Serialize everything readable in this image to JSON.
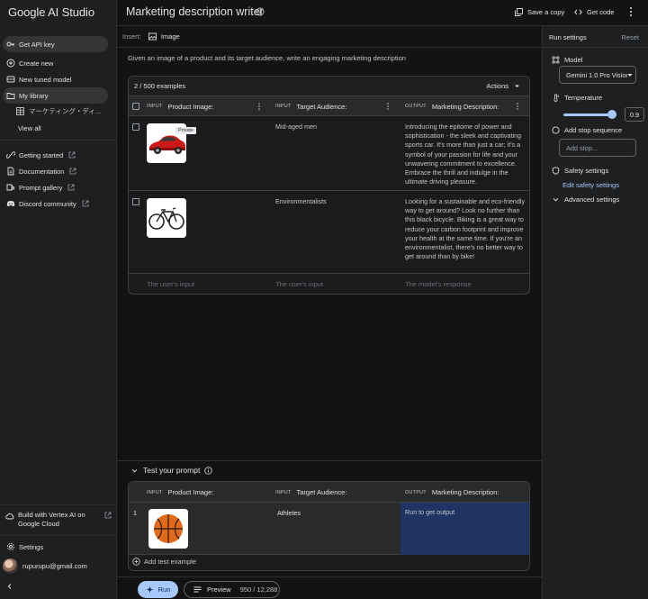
{
  "app": {
    "brand": "Google AI Studio"
  },
  "sidebar": {
    "items": [
      {
        "label": "Get API key",
        "icon": "key-icon"
      },
      {
        "label": "Create new",
        "icon": "plus-circle-icon"
      },
      {
        "label": "New tuned model",
        "icon": "tune-icon"
      },
      {
        "label": "My library",
        "icon": "folder-icon"
      },
      {
        "label": "マーケティング・ディ...",
        "icon": "table-icon"
      },
      {
        "label": "View all"
      },
      {
        "label": "Getting started",
        "icon": "link-icon"
      },
      {
        "label": "Documentation",
        "icon": "document-icon"
      },
      {
        "label": "Prompt gallery",
        "icon": "gallery-icon"
      },
      {
        "label": "Discord community",
        "icon": "discord-icon"
      }
    ],
    "vertex": "Build with Vertex AI on Google Cloud",
    "settings": "Settings",
    "user_email": "rupurupu@gmail.com"
  },
  "header": {
    "title": "Marketing description writer",
    "save_copy": "Save a copy",
    "get_code": "Get code"
  },
  "insert": {
    "label": "Insert:",
    "image": "Image"
  },
  "instruction": "Given an image of a product and its target audience, write an engaging marketing description",
  "examples": {
    "count": "2 / 500 examples",
    "actions": "Actions",
    "columns": [
      {
        "tag": "INPUT",
        "label": "Product Image:"
      },
      {
        "tag": "INPUT",
        "label": "Target Audience:"
      },
      {
        "tag": "OUTPUT",
        "label": "Marketing Description:"
      }
    ],
    "rows": [
      {
        "image": "red-sports-car",
        "badge": "Private",
        "audience": "Mid-aged men",
        "output": "Introducing the epitome of power and sophistication - the sleek and captivating sports car. It's more than just a car; it's a symbol of your passion for life and your unwavering commitment to excellence. Embrace the thrill and indulge in the ultimate driving pleasure."
      },
      {
        "image": "black-bicycle",
        "audience": "Environmentalists",
        "output": "Looking for a sustainable and eco-friendly way to get around? Look no further than this black bicycle. Biking is a great way to reduce your carbon footprint and improve your health at the same time. If you're an environmentalist, there's no better way to get around than by bike!"
      }
    ],
    "placeholders": [
      "The user's input",
      "The user's input",
      "The model's response"
    ]
  },
  "test": {
    "title": "Test your prompt",
    "columns": [
      {
        "tag": "INPUT",
        "label": "Product Image:"
      },
      {
        "tag": "INPUT",
        "label": "Target Audience:"
      },
      {
        "tag": "OUTPUT",
        "label": "Marketing Description:"
      }
    ],
    "row": {
      "number": "1",
      "image": "basketball",
      "audience": "Athletes",
      "output": "Run to get output"
    },
    "add_example": "Add test example"
  },
  "bottom": {
    "run": "Run",
    "preview": "Preview",
    "tokens": "950 / 12,288"
  },
  "run_settings": {
    "title": "Run settings",
    "reset": "Reset",
    "model_label": "Model",
    "model_value": "Gemini 1.0 Pro Vision",
    "temperature_label": "Temperature",
    "temperature_value": "0.9",
    "temperature_fraction": 0.9,
    "stop_label": "Add stop sequence",
    "stop_placeholder": "Add stop...",
    "safety_label": "Safety settings",
    "safety_link": "Edit safety settings",
    "advanced_label": "Advanced settings"
  },
  "colors": {
    "background": "#131314",
    "surface": "#1e1f20",
    "accent": "#a8c7fa",
    "output_highlight": "#1f3462"
  }
}
